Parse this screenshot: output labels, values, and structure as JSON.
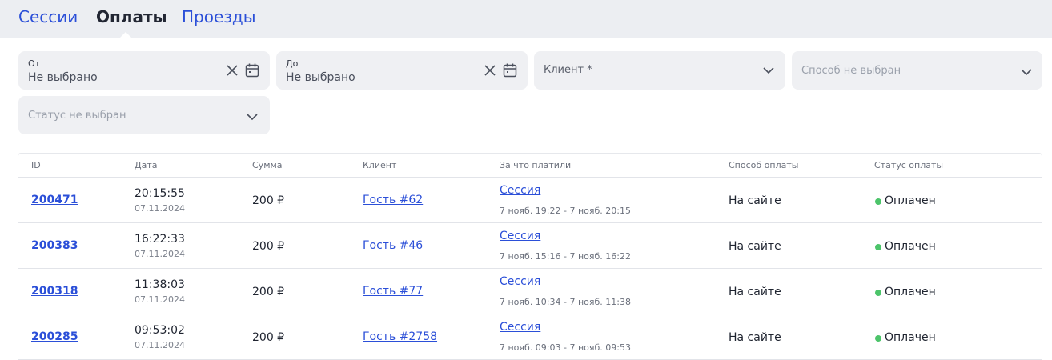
{
  "tabs": [
    {
      "label": "Сессии",
      "active": false
    },
    {
      "label": "Оплаты",
      "active": true
    },
    {
      "label": "Проезды",
      "active": false
    }
  ],
  "filters": {
    "from": {
      "label": "От",
      "value": "Не выбрано"
    },
    "to": {
      "label": "До",
      "value": "Не выбрано"
    },
    "client": {
      "placeholder": "Клиент *"
    },
    "method": {
      "placeholder": "Способ не выбран"
    },
    "status": {
      "placeholder": "Статус не выбран"
    }
  },
  "table": {
    "columns": [
      "ID",
      "Дата",
      "Сумма",
      "Клиент",
      "За что платили",
      "Способ оплаты",
      "Статус оплаты"
    ],
    "rows": [
      {
        "id": "200471",
        "time": "20:15:55",
        "date": "07.11.2024",
        "amount": "200 ₽",
        "client": "Гость #62",
        "for": "Сессия",
        "period": "7 нояб. 19:22 - 7 нояб. 20:15",
        "method": "На сайте",
        "status": "Оплачен"
      },
      {
        "id": "200383",
        "time": "16:22:33",
        "date": "07.11.2024",
        "amount": "200 ₽",
        "client": "Гость #46",
        "for": "Сессия",
        "period": "7 нояб. 15:16 - 7 нояб. 16:22",
        "method": "На сайте",
        "status": "Оплачен"
      },
      {
        "id": "200318",
        "time": "11:38:03",
        "date": "07.11.2024",
        "amount": "200 ₽",
        "client": "Гость #77",
        "for": "Сессия",
        "period": "7 нояб. 10:34 - 7 нояб. 11:38",
        "method": "На сайте",
        "status": "Оплачен"
      },
      {
        "id": "200285",
        "time": "09:53:02",
        "date": "07.11.2024",
        "amount": "200 ₽",
        "client": "Гость #2758",
        "for": "Сессия",
        "period": "7 нояб. 09:03 - 7 нояб. 09:53",
        "method": "На сайте",
        "status": "Оплачен"
      }
    ]
  },
  "colors": {
    "accent": "#2b4fd8",
    "status_paid": "#4cc46a",
    "field_bg": "#eff0f3",
    "tabs_bg": "#eceef2"
  }
}
